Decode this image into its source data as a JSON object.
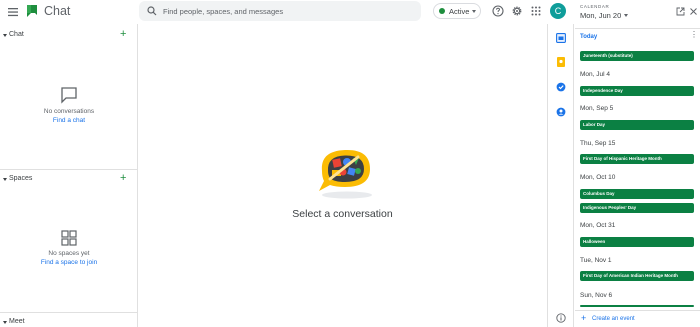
{
  "app": {
    "title": "Chat"
  },
  "search": {
    "placeholder": "Find people, spaces, and messages"
  },
  "status": {
    "label": "Active",
    "color": "#1e8e3e"
  },
  "account": {
    "initial": "C",
    "color": "#0f9d9a"
  },
  "left_panel": {
    "chat": {
      "title": "Chat",
      "empty_text": "No conversations",
      "link": "Find a chat"
    },
    "spaces": {
      "title": "Spaces",
      "empty_text": "No spaces yet",
      "link": "Find a space to join"
    },
    "meet": {
      "title": "Meet"
    }
  },
  "main": {
    "prompt": "Select a conversation"
  },
  "calendar": {
    "label": "CALENDAR",
    "date": "Mon, Jun 20",
    "today_label": "Today",
    "create_label": "Create an event",
    "event_color": "#0b8043",
    "today_event": "Juneteenth (substitute)",
    "days": [
      {
        "date": "Mon, Jul 4",
        "events": [
          "Independence Day"
        ]
      },
      {
        "date": "Mon, Sep 5",
        "events": [
          "Labor Day"
        ]
      },
      {
        "date": "Thu, Sep 15",
        "events": [
          "First Day of Hispanic Heritage Month"
        ]
      },
      {
        "date": "Mon, Oct 10",
        "events": [
          "Columbus Day",
          "Indigenous Peoples' Day"
        ]
      },
      {
        "date": "Mon, Oct 31",
        "events": [
          "Halloween"
        ]
      },
      {
        "date": "Tue, Nov 1",
        "events": [
          "First Day of American Indian Heritage Month"
        ]
      },
      {
        "date": "Sun, Nov 6",
        "events": []
      }
    ]
  }
}
